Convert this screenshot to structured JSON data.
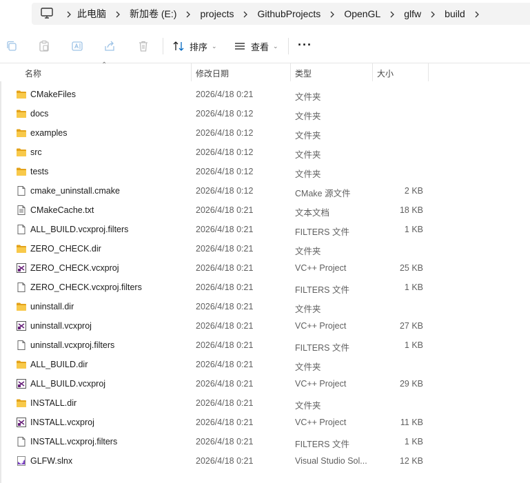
{
  "address": {
    "crumbs": [
      "此电脑",
      "新加卷 (E:)",
      "projects",
      "GithubProjects",
      "OpenGL",
      "glfw",
      "build"
    ]
  },
  "toolbar": {
    "sort_label": "排序",
    "view_label": "查看"
  },
  "columns": {
    "name": "名称",
    "date": "修改日期",
    "type": "类型",
    "size": "大小"
  },
  "files": [
    {
      "icon": "folder-icon",
      "name": "CMakeFiles",
      "date": "2026/4/18 0:21",
      "type": "文件夹",
      "size": ""
    },
    {
      "icon": "folder-icon",
      "name": "docs",
      "date": "2026/4/18 0:12",
      "type": "文件夹",
      "size": ""
    },
    {
      "icon": "folder-icon",
      "name": "examples",
      "date": "2026/4/18 0:12",
      "type": "文件夹",
      "size": ""
    },
    {
      "icon": "folder-icon",
      "name": "src",
      "date": "2026/4/18 0:12",
      "type": "文件夹",
      "size": ""
    },
    {
      "icon": "folder-icon",
      "name": "tests",
      "date": "2026/4/18 0:12",
      "type": "文件夹",
      "size": ""
    },
    {
      "icon": "file-icon",
      "name": "cmake_uninstall.cmake",
      "date": "2026/4/18 0:12",
      "type": "CMake 源文件",
      "size": "2 KB"
    },
    {
      "icon": "text-file-icon",
      "name": "CMakeCache.txt",
      "date": "2026/4/18 0:21",
      "type": "文本文档",
      "size": "18 KB"
    },
    {
      "icon": "file-icon",
      "name": "ALL_BUILD.vcxproj.filters",
      "date": "2026/4/18 0:21",
      "type": "FILTERS 文件",
      "size": "1 KB"
    },
    {
      "icon": "folder-icon",
      "name": "ZERO_CHECK.dir",
      "date": "2026/4/18 0:21",
      "type": "文件夹",
      "size": ""
    },
    {
      "icon": "vcxproj-icon",
      "name": "ZERO_CHECK.vcxproj",
      "date": "2026/4/18 0:21",
      "type": "VC++ Project",
      "size": "25 KB"
    },
    {
      "icon": "file-icon",
      "name": "ZERO_CHECK.vcxproj.filters",
      "date": "2026/4/18 0:21",
      "type": "FILTERS 文件",
      "size": "1 KB"
    },
    {
      "icon": "folder-icon",
      "name": "uninstall.dir",
      "date": "2026/4/18 0:21",
      "type": "文件夹",
      "size": ""
    },
    {
      "icon": "vcxproj-icon",
      "name": "uninstall.vcxproj",
      "date": "2026/4/18 0:21",
      "type": "VC++ Project",
      "size": "27 KB"
    },
    {
      "icon": "file-icon",
      "name": "uninstall.vcxproj.filters",
      "date": "2026/4/18 0:21",
      "type": "FILTERS 文件",
      "size": "1 KB"
    },
    {
      "icon": "folder-icon",
      "name": "ALL_BUILD.dir",
      "date": "2026/4/18 0:21",
      "type": "文件夹",
      "size": ""
    },
    {
      "icon": "vcxproj-icon",
      "name": "ALL_BUILD.vcxproj",
      "date": "2026/4/18 0:21",
      "type": "VC++ Project",
      "size": "29 KB"
    },
    {
      "icon": "folder-icon",
      "name": "INSTALL.dir",
      "date": "2026/4/18 0:21",
      "type": "文件夹",
      "size": ""
    },
    {
      "icon": "vcxproj-icon",
      "name": "INSTALL.vcxproj",
      "date": "2026/4/18 0:21",
      "type": "VC++ Project",
      "size": "11 KB"
    },
    {
      "icon": "file-icon",
      "name": "INSTALL.vcxproj.filters",
      "date": "2026/4/18 0:21",
      "type": "FILTERS 文件",
      "size": "1 KB"
    },
    {
      "icon": "slnx-icon",
      "name": "GLFW.slnx",
      "date": "2026/4/18 0:21",
      "type": "Visual Studio Sol...",
      "size": "12 KB"
    }
  ],
  "colors": {
    "folder": "#f8c94a",
    "folder_dark": "#e3a21a",
    "accent": "#0067c0"
  }
}
